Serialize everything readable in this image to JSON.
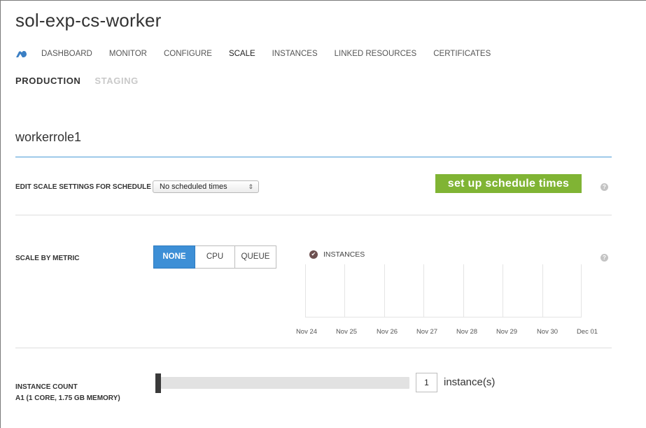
{
  "header": {
    "title": "sol-exp-cs-worker"
  },
  "nav": {
    "logo_icon": "cloud-service-icon",
    "items": [
      {
        "label": "DASHBOARD",
        "active": false
      },
      {
        "label": "MONITOR",
        "active": false
      },
      {
        "label": "CONFIGURE",
        "active": false
      },
      {
        "label": "SCALE",
        "active": true
      },
      {
        "label": "INSTANCES",
        "active": false
      },
      {
        "label": "LINKED RESOURCES",
        "active": false
      },
      {
        "label": "CERTIFICATES",
        "active": false
      }
    ]
  },
  "environment": {
    "production_label": "PRODUCTION",
    "staging_label": "STAGING",
    "selected": "PRODUCTION"
  },
  "role": {
    "name": "workerrole1"
  },
  "schedule": {
    "label": "EDIT SCALE SETTINGS FOR SCHEDULE",
    "selected_option": "No scheduled times",
    "setup_button_label": "set up schedule times",
    "help_icon": "?"
  },
  "metric": {
    "label": "SCALE BY METRIC",
    "options": [
      "NONE",
      "CPU",
      "QUEUE"
    ],
    "selected": "NONE",
    "help_icon": "?"
  },
  "chart": {
    "legend_label": "INSTANCES",
    "legend_icon": "✔"
  },
  "chart_data": {
    "type": "line",
    "title": "",
    "xlabel": "",
    "ylabel": "",
    "categories": [
      "Nov 24",
      "Nov 25",
      "Nov 26",
      "Nov 27",
      "Nov 28",
      "Nov 29",
      "Nov 30",
      "Dec 01"
    ],
    "series": [
      {
        "name": "INSTANCES",
        "values": []
      }
    ],
    "grid": true
  },
  "instance_count": {
    "label": "INSTANCE COUNT",
    "sublabel": "A1 (1 CORE, 1.75 GB MEMORY)",
    "value": "1",
    "unit": "instance(s)",
    "slider_fraction": 0
  },
  "colors": {
    "accent_blue": "#3d8fd6",
    "green_button": "#80b434",
    "role_underline": "#4a9ad6",
    "legend_check": "#6d5050"
  }
}
